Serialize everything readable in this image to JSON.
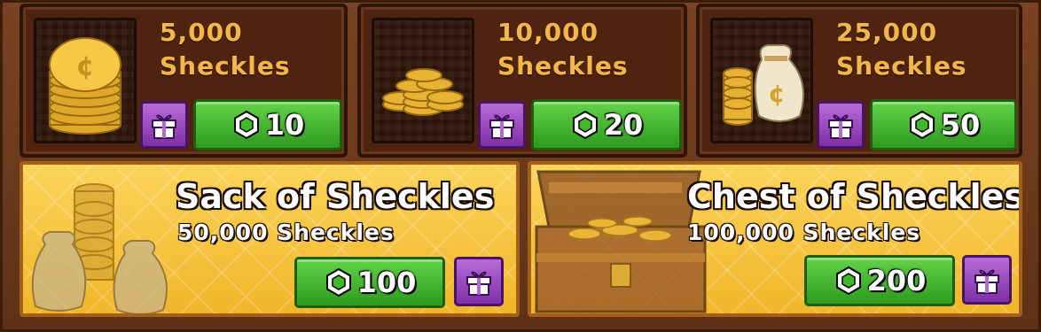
{
  "offers_small": [
    {
      "amount": "5,000",
      "unit": "Sheckles",
      "price": "10",
      "icon": "coin-stack-icon"
    },
    {
      "amount": "10,000",
      "unit": "Sheckles",
      "price": "20",
      "icon": "coin-pile-icon"
    },
    {
      "amount": "25,000",
      "unit": "Sheckles",
      "price": "50",
      "icon": "coin-bag-icon"
    }
  ],
  "offers_large": [
    {
      "title": "Sack of Sheckles",
      "subtitle": "50,000 Sheckles",
      "price": "100",
      "icon": "coin-sacks-icon"
    },
    {
      "title": "Chest of Sheckles",
      "subtitle": "100,000 Sheckles",
      "price": "200",
      "icon": "treasure-chest-icon"
    }
  ],
  "colors": {
    "buy_green": "#3fb82a",
    "gift_purple": "#9a42c4",
    "gold_text": "#f3b64a",
    "card_gold": "#f7c33a"
  }
}
